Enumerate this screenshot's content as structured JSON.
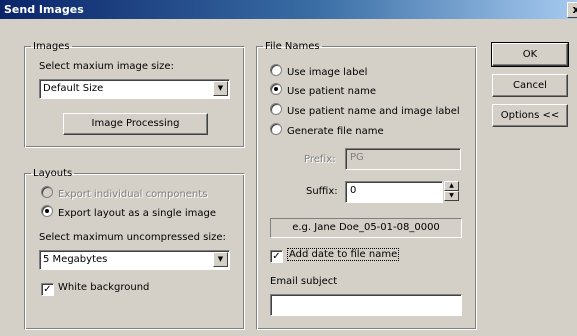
{
  "window": {
    "title": "Send Images",
    "close_glyph": "x"
  },
  "images_group": {
    "legend": "Images",
    "size_label": "Select maxium image size:",
    "size_value": "Default Size",
    "processing_button": "Image Processing"
  },
  "layouts_group": {
    "legend": "Layouts",
    "opt_individual": "Export individual components",
    "opt_single": "Export layout as a single image",
    "size_label": "Select maximum uncompressed size:",
    "size_value": "5 Megabytes",
    "white_bg": "White background"
  },
  "filenames_group": {
    "legend": "File Names",
    "opt_image_label": "Use image label",
    "opt_patient_name": "Use patient name",
    "opt_patient_and_label": "Use patient name and image label",
    "opt_generate": "Generate file name",
    "prefix_label": "Prefix:",
    "prefix_value": "PG",
    "suffix_label": "Suffix:",
    "suffix_value": "0",
    "example": "e.g. Jane Doe_05-01-08_0000",
    "add_date": "Add date to file name",
    "email_label": "Email subject",
    "email_value": ""
  },
  "buttons": {
    "ok": "OK",
    "cancel": "Cancel",
    "options": "Options <<"
  },
  "state": {
    "layout_mode": "single",
    "file_name_mode": "patient_name",
    "white_background": true,
    "add_date": true
  }
}
